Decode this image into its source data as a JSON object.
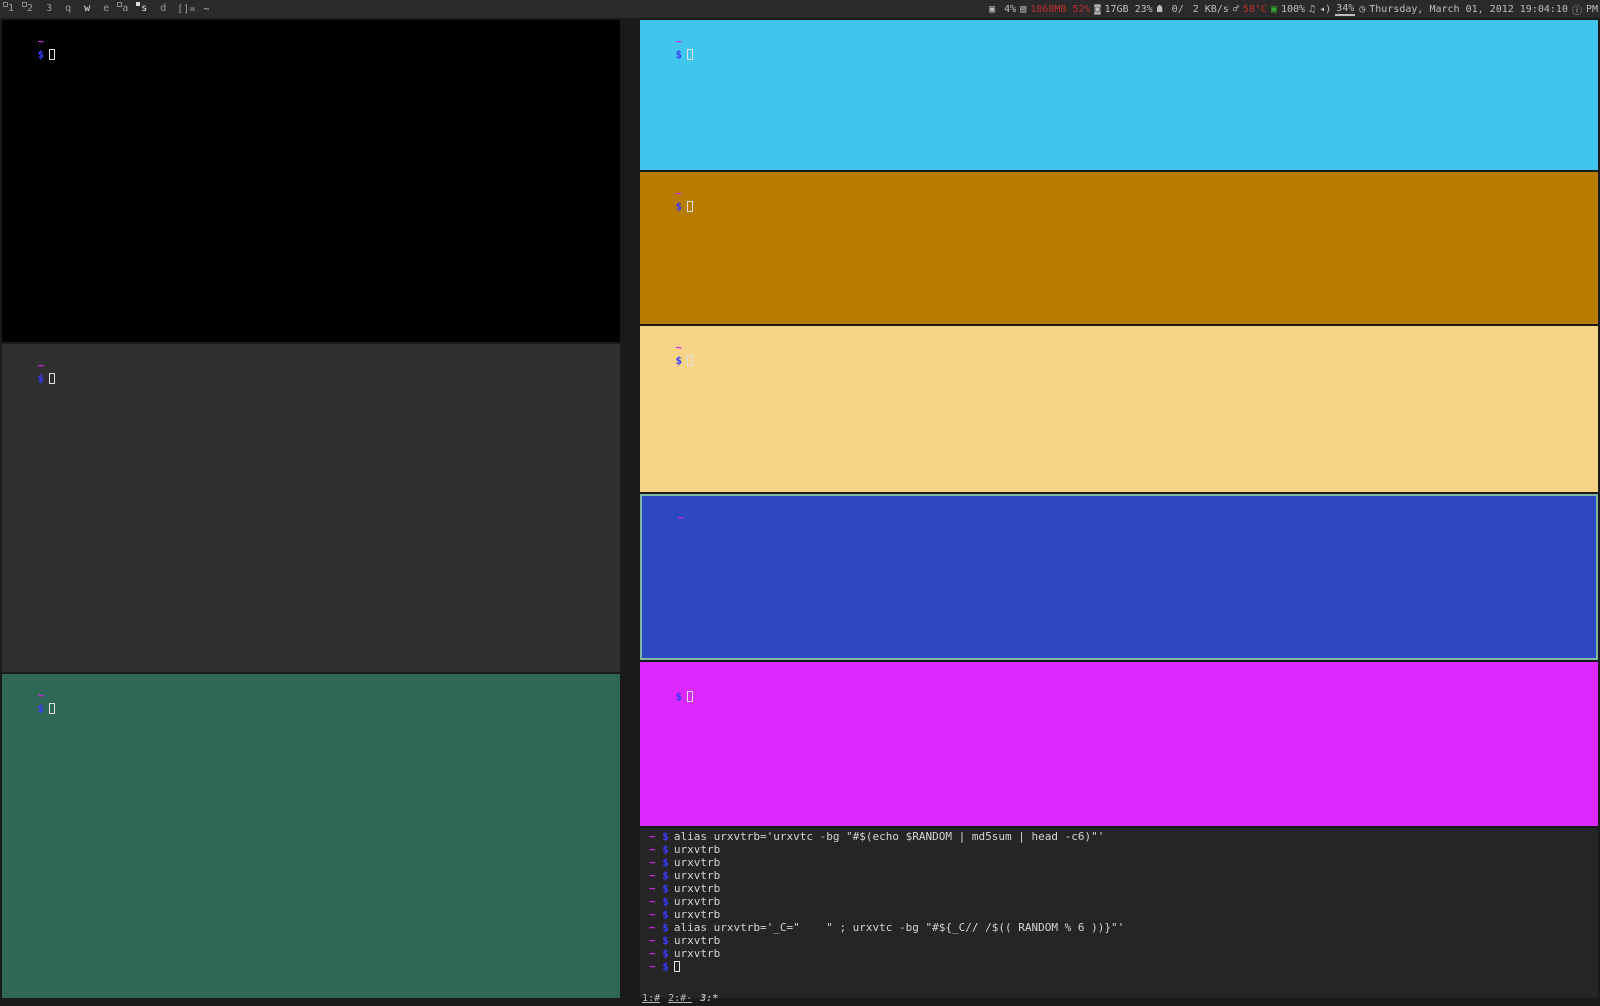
{
  "taskbar": {
    "tags": [
      {
        "label": "1",
        "state": "occupied"
      },
      {
        "label": "2",
        "state": "occupied"
      },
      {
        "label": "3",
        "state": "empty"
      },
      {
        "label": "q",
        "state": "empty"
      },
      {
        "label": "w",
        "state": "selected"
      },
      {
        "label": "e",
        "state": "empty"
      },
      {
        "label": "a",
        "state": "occupied"
      },
      {
        "label": "s",
        "state": "focused"
      },
      {
        "label": "d",
        "state": "empty"
      }
    ],
    "layout": "[]=",
    "title": "~",
    "cpu": "4%",
    "mem": "1868MB 52%",
    "disk": "17GB 23%",
    "net_io": "0/",
    "net_speed": "2 KB/s",
    "temp": "58°C",
    "battery": "100%",
    "volume": "34%",
    "datetime": "Thursday, March 01, 2012 19:04:10",
    "period": "PM"
  },
  "prompt": {
    "tilde": "~",
    "dollar": "$"
  },
  "terminals": {
    "left_top": {
      "bg": "#000000"
    },
    "left_mid": {
      "bg": "#303030"
    },
    "left_bottom": {
      "bg": "#306858"
    },
    "right_1": {
      "bg": "#40c6ed"
    },
    "right_2": {
      "bg": "#b87c00"
    },
    "right_3": {
      "bg": "#f5d488"
    },
    "right_4": {
      "bg": "#2e47c3"
    },
    "right_5": {
      "bg": "#dd28ff"
    },
    "right_6": {
      "bg": "#252525"
    }
  },
  "command_log": [
    "alias urxvtrb='urxvtc -bg \"#$(echo $RANDOM | md5sum | head -c6)\"'",
    "urxvtrb",
    "urxvtrb",
    "urxvtrb",
    "urxvtrb",
    "urxvtrb",
    "urxvtrb",
    "alias urxvtrb='_C=\"    \" ; urxvtc -bg \"#${_C// /$(( RANDOM % 6 ))}\"'",
    "urxvtrb",
    "urxvtrb"
  ],
  "tmux": {
    "win1": "1:#",
    "win2": "2:#-",
    "win3": "3:*"
  }
}
